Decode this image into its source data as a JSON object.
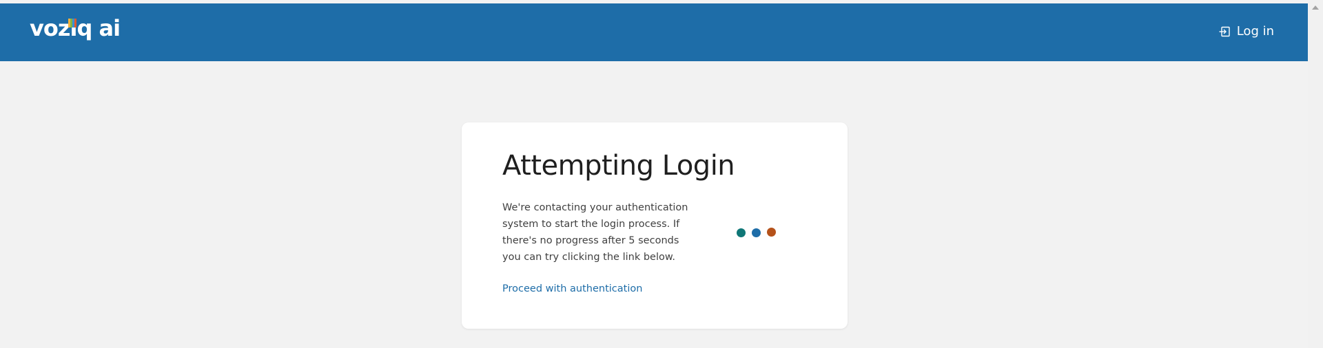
{
  "header": {
    "logo_text": "voziq ai",
    "login_label": "Log in",
    "login_icon": "sign-in-icon",
    "background_color": "#1e6da8"
  },
  "card": {
    "title": "Attempting Login",
    "body": "We're contacting your authentication system to start the login process. If there's no progress after 5 seconds you can try clicking the link below.",
    "link_label": "Proceed with authentication"
  },
  "loader": {
    "dot_colors": [
      "#0f7777",
      "#1e6da8",
      "#b5521a"
    ]
  },
  "colors": {
    "page_background": "#f2f2f2",
    "card_background": "#ffffff",
    "link": "#1e6da8"
  }
}
